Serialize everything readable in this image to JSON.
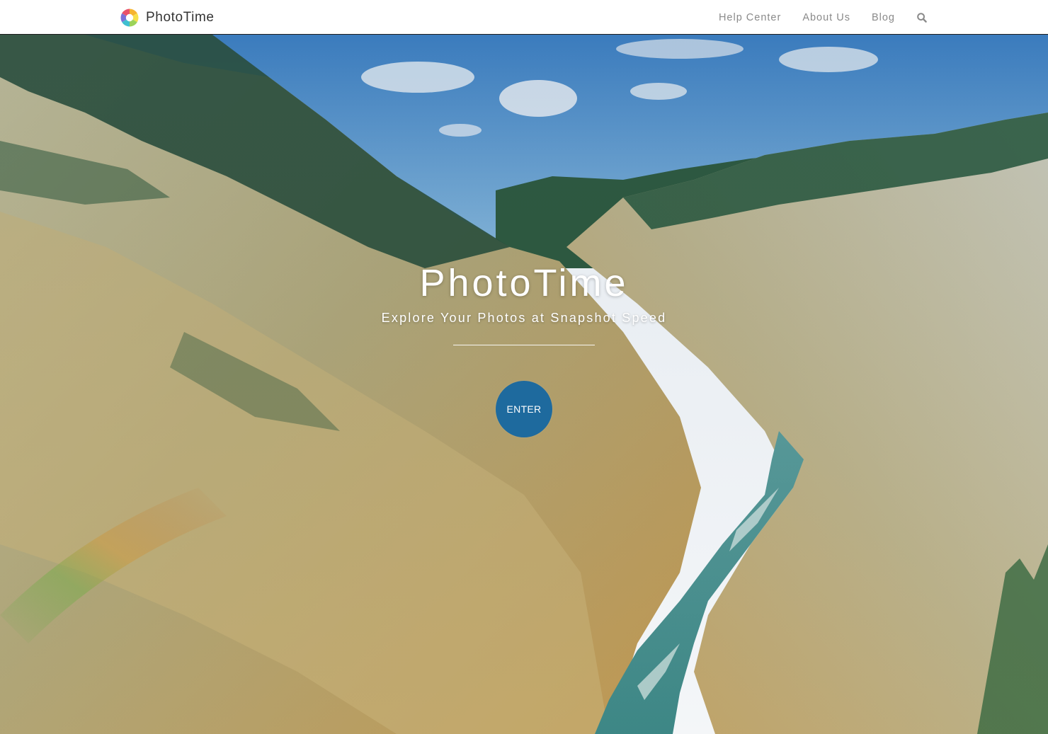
{
  "navbar": {
    "brand_name": "PhotoTime",
    "logo_icon": "rainbow-circle-logo",
    "links": [
      {
        "label": "Help Center"
      },
      {
        "label": "About Us"
      },
      {
        "label": "Blog"
      }
    ],
    "search_icon": "search-icon"
  },
  "hero": {
    "background": "canyon-river-landscape-photo",
    "title": "PhotoTime",
    "subtitle": "Explore Your Photos at Snapshot Speed",
    "enter_label": "ENTER"
  },
  "colors": {
    "navbar_bg": "#ffffff",
    "brand_text": "#333333",
    "nav_link": "#8a8a8a",
    "enter_button": "#1e6a9e",
    "hero_text": "#ffffff"
  }
}
